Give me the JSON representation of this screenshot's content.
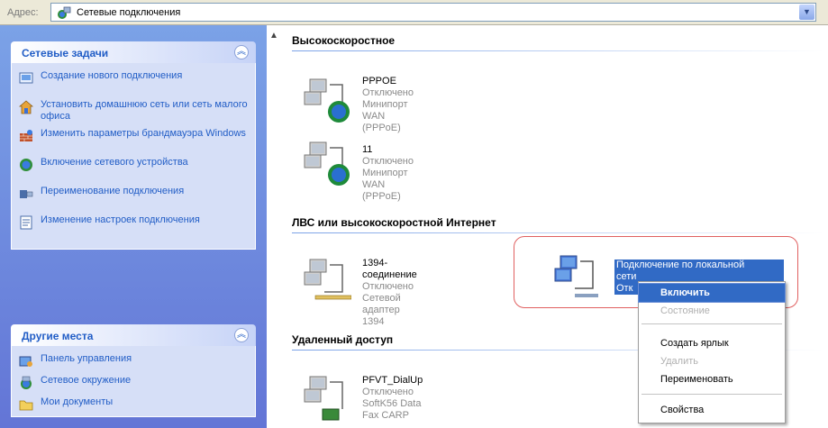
{
  "address": {
    "label": "Адрес:",
    "value": "Сетевые подключения"
  },
  "left": {
    "network_tasks": {
      "title": "Сетевые задачи",
      "items": [
        {
          "label": "Создание нового подключения",
          "icon": "new-connection-icon"
        },
        {
          "label": "Установить домашнюю сеть или сеть малого офиса",
          "icon": "home-network-icon"
        },
        {
          "label": "Изменить параметры брандмауэра Windows",
          "icon": "firewall-icon"
        },
        {
          "label": "Включение сетевого устройства",
          "icon": "network-device-icon"
        },
        {
          "label": "Переименование подключения",
          "icon": "rename-icon"
        },
        {
          "label": "Изменение настроек подключения",
          "icon": "settings-icon"
        }
      ]
    },
    "other_places": {
      "title": "Другие места",
      "items": [
        {
          "label": "Панель управления",
          "icon": "control-panel-icon"
        },
        {
          "label": "Сетевое окружение",
          "icon": "network-neighborhood-icon"
        },
        {
          "label": "Мои документы",
          "icon": "my-documents-icon"
        }
      ]
    }
  },
  "main": {
    "groups": [
      {
        "title": "Высокоскоростное"
      },
      {
        "title": "ЛВС или высокоскоростной Интернет"
      },
      {
        "title": "Удаленный доступ"
      }
    ],
    "connections": [
      {
        "name": "PPPOE",
        "status": "Отключено",
        "device": "Минипорт WAN (PPPoE)"
      },
      {
        "name": "11",
        "status": "Отключено",
        "device": "Минипорт WAN (PPPoE)"
      },
      {
        "name": "1394-соединение",
        "status": "Отключено",
        "device": "Сетевой адаптер 1394"
      },
      {
        "name": "Подключение по локальной сети",
        "status": "Отключено",
        "device": ""
      },
      {
        "name": "PFVT_DialUp",
        "status": "Отключено",
        "device": "SoftK56 Data Fax CARP"
      }
    ],
    "selected_name_line1": "Подключение по локальной",
    "selected_name_line2": "сети",
    "selected_status_prefix": "Отк"
  },
  "context_menu": {
    "items": [
      {
        "label": "Включить",
        "state": "selected"
      },
      {
        "label": "Состояние",
        "state": "disabled"
      },
      {
        "label": "Создать ярлык",
        "state": "normal"
      },
      {
        "label": "Удалить",
        "state": "disabled"
      },
      {
        "label": "Переименовать",
        "state": "normal"
      },
      {
        "label": "Свойства",
        "state": "normal"
      }
    ]
  },
  "colors": {
    "task_link": "#215dc6",
    "selection": "#316ac5",
    "pane_top": "#7ba2e7",
    "pane_bottom": "#6375d6",
    "highlight_ring": "#e06060"
  }
}
